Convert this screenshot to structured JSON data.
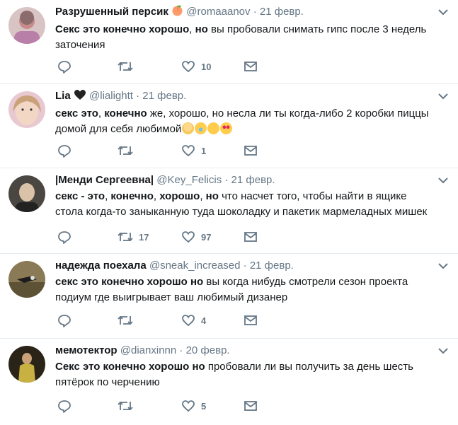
{
  "tweets": [
    {
      "name": "Разрушенный персик",
      "name_emoji": "peach-emoji",
      "handle": "@romaaanov",
      "dot": "·",
      "date": "21 февр.",
      "text_bold": "Секс это конечно хорошо",
      "text_sep": ", ",
      "text_bold2": "но",
      "text_rest": " вы пробовали снимать гипс после 3 недель заточения",
      "retweets": "",
      "likes": "10",
      "avatar_color": "#c88b8b"
    },
    {
      "name": "Lia",
      "name_emoji": "black-heart-emoji",
      "handle": "@lialightt",
      "dot": "·",
      "date": "21 февр.",
      "text_bold": "секс это",
      "text_sep": ", ",
      "text_bold2": "конечно",
      "text_rest": " же, хорошо, но несла ли ты когда-либо 2 коробки пиццы домой для себя любимой",
      "emojis": [
        "woman-tipping-hand-emoji",
        "joy-emoji",
        "thinking-emoji",
        "heart-eyes-emoji"
      ],
      "retweets": "",
      "likes": "1",
      "avatar_color": "#d9a9b8"
    },
    {
      "name": "|Менди Сергеевна|",
      "handle": "@Key_Felicis",
      "dot": "·",
      "date": "21 февр.",
      "text_bold": "секс - это",
      "text_sep": ", ",
      "text_bold2": "конечно",
      "text_sep2": ", ",
      "text_bold3": "хорошо",
      "text_sep3": ", ",
      "text_bold4": "но",
      "text_rest": " что насчет того, чтобы найти в ящике стола когда-то заныканную туда шоколадку и пакетик мармеладных мишек",
      "retweets": "17",
      "likes": "97",
      "avatar_color": "#3d3a36"
    },
    {
      "name": "надежда поехала",
      "handle": "@sneak_increased",
      "dot": "·",
      "date": "21 февр.",
      "text_bold": "секс это конечно хорошо но",
      "text_rest": " вы когда нибудь смотрели сезон проекта подиум где выигрывает ваш любимый дизанер",
      "retweets": "",
      "likes": "4",
      "avatar_color": "#6b5a3c"
    },
    {
      "name": "мемотектор",
      "handle": "@dianxinnn",
      "dot": "·",
      "date": "20 февр.",
      "text_bold": "Секс это конечно хорошо но",
      "text_rest": " пробовали ли вы получить за день шесть пятёрок по черчению",
      "retweets": "",
      "likes": "5",
      "avatar_color": "#2a2418"
    }
  ],
  "colors": {
    "text": "#14171a",
    "secondary": "#657786",
    "divider": "#e6ecf0"
  },
  "icons": [
    "reply-icon",
    "retweet-icon",
    "like-icon",
    "direct-message-icon",
    "caret-down-icon"
  ]
}
